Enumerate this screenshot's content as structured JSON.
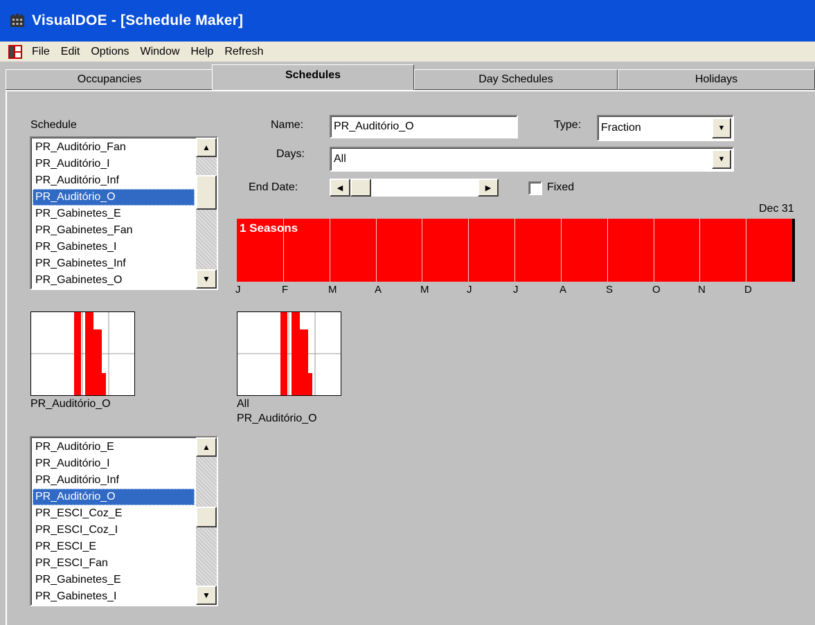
{
  "window": {
    "title": "VisualDOE - [Schedule Maker]"
  },
  "menu": [
    "File",
    "Edit",
    "Options",
    "Window",
    "Help",
    "Refresh"
  ],
  "tabs": [
    {
      "label": "Occupancies",
      "active": false
    },
    {
      "label": "Schedules",
      "active": true
    },
    {
      "label": "Day Schedules",
      "active": false
    },
    {
      "label": "Holidays",
      "active": false
    }
  ],
  "schedule": {
    "label": "Schedule",
    "items": [
      "PR_Auditório_Fan",
      "PR_Auditório_I",
      "PR_Auditório_Inf",
      "PR_Auditório_O",
      "PR_Gabinetes_E",
      "PR_Gabinetes_Fan",
      "PR_Gabinetes_I",
      "PR_Gabinetes_Inf",
      "PR_Gabinetes_O"
    ],
    "selected_index": 3
  },
  "form": {
    "name_label": "Name:",
    "name_value": "PR_Auditório_O",
    "type_label": "Type:",
    "type_value": "Fraction",
    "days_label": "Days:",
    "days_value": "All",
    "end_date_label": "End Date:",
    "fixed_label": "Fixed",
    "fixed_checked": false
  },
  "season_chart": {
    "end_label": "Dec 31",
    "season_text": "1 Seasons",
    "months": [
      "J",
      "F",
      "M",
      "A",
      "M",
      "J",
      "J",
      "A",
      "S",
      "O",
      "N",
      "D"
    ],
    "bar_color": "#ff0000"
  },
  "previews": [
    {
      "caption_line1": "PR_Auditório_O",
      "caption_line2": ""
    },
    {
      "caption_line1": "All",
      "caption_line2": "PR_Auditório_O"
    }
  ],
  "day_list": {
    "items": [
      "PR_Auditório_E",
      "PR_Auditório_I",
      "PR_Auditório_Inf",
      "PR_Auditório_O",
      "PR_ESCI_Coz_E",
      "PR_ESCI_Coz_I",
      "PR_ESCI_E",
      "PR_ESCI_Fan",
      "PR_Gabinetes_E",
      "PR_Gabinetes_I"
    ],
    "selected_index": 3
  },
  "colors": {
    "titlebar": "#0a50d8",
    "selection": "#316ac5",
    "season": "#ff0000"
  }
}
